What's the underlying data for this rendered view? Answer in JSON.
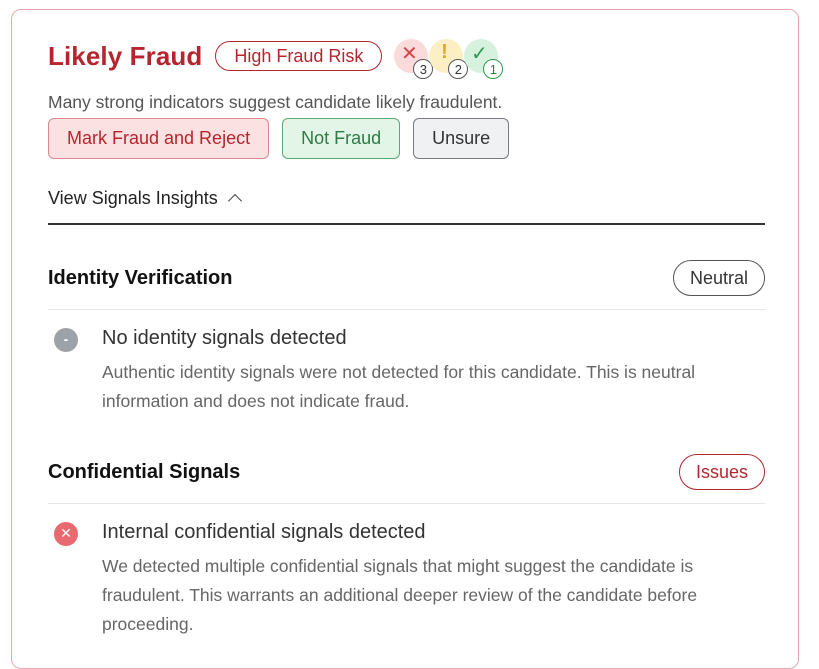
{
  "header": {
    "status_title": "Likely Fraud",
    "risk_label": "High Fraud Risk",
    "summary": "Many strong indicators suggest candidate likely fraudulent.",
    "signals": [
      {
        "icon": "x-icon",
        "glyph": "✕",
        "count": "3",
        "color": "#d9434b"
      },
      {
        "icon": "exclamation-icon",
        "glyph": "!",
        "count": "2",
        "color": "#e2a81a"
      },
      {
        "icon": "check-icon",
        "glyph": "✓",
        "count": "1",
        "color": "#2f9a51"
      }
    ]
  },
  "actions": {
    "mark_fraud": "Mark Fraud and Reject",
    "not_fraud": "Not Fraud",
    "unsure": "Unsure"
  },
  "insights": {
    "toggle_label": "View Signals Insights",
    "toggle_icon": "chevron-up-icon"
  },
  "sections": [
    {
      "title": "Identity Verification",
      "badge": "Neutral",
      "items": [
        {
          "icon": "neutral-dot-icon",
          "glyph": "-",
          "title": "No identity signals detected",
          "text": "Authentic identity signals were not detected for this candidate. This is neutral information and does not indicate fraud."
        }
      ]
    },
    {
      "title": "Confidential Signals",
      "badge": "Issues",
      "items": [
        {
          "icon": "x-circle-icon",
          "glyph": "✕",
          "title": "Internal confidential signals detected",
          "text": "We detected multiple confidential signals that might suggest the candidate is fraudulent. This warrants an additional deeper review of the candidate before proceeding."
        }
      ]
    }
  ],
  "colors": {
    "danger": "#b3262e",
    "success": "#2f7a46",
    "border": "#e8a8ab"
  }
}
